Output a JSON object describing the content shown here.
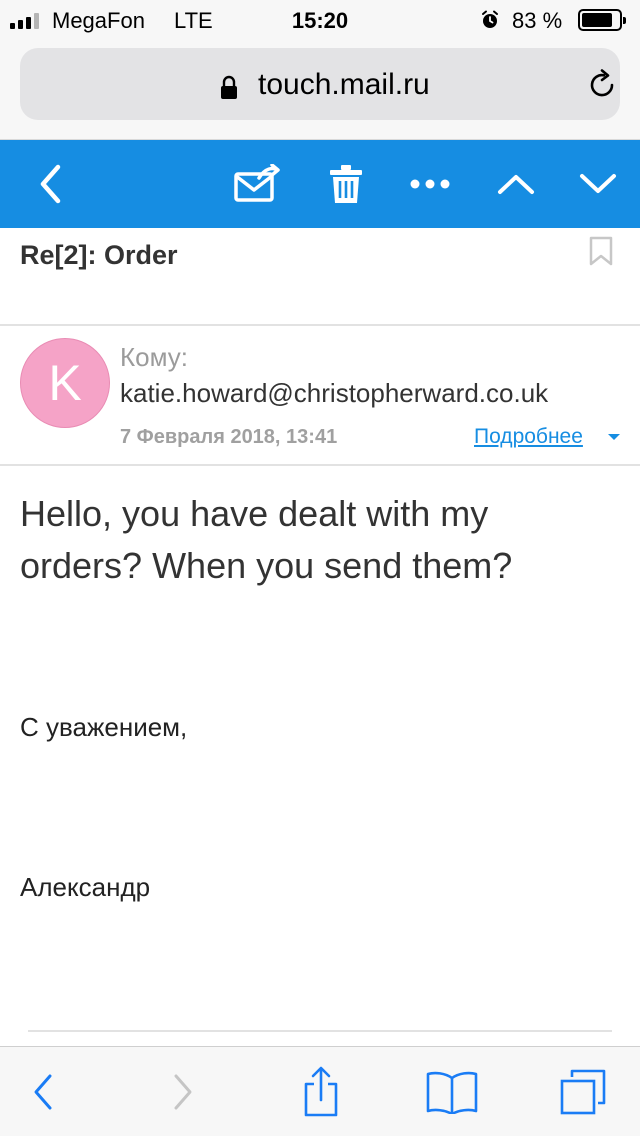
{
  "status_bar": {
    "carrier": "MegaFon",
    "network": "LTE",
    "time": "15:20",
    "battery_percent": "83 %",
    "battery_level": 0.83,
    "icons": [
      "signal-icon",
      "alarm-icon",
      "battery-icon"
    ]
  },
  "browser": {
    "url": "touch.mail.ru",
    "icons": [
      "lock-icon",
      "reload-icon"
    ]
  },
  "mail_toolbar": {
    "color": "#168de2",
    "buttons": [
      "back-icon",
      "move-icon",
      "trash-icon",
      "more-icon",
      "prev-message-icon",
      "next-message-icon"
    ]
  },
  "message": {
    "subject": "Re[2]: Order",
    "avatar_letter": "K",
    "avatar_color": "#f5a3c7",
    "to_label": "Кому:",
    "to_email": "katie.howard@christopherward.co.uk",
    "date": "7 Февраля 2018, 13:41",
    "details_link": "Подробнее",
    "body": "Hello, you have dealt with my orders? When you send them?",
    "signature_line1": "С уважением,",
    "signature_line2": "Александр"
  },
  "safari_toolbar": {
    "accent": "#1a7cf5",
    "buttons": [
      "back-icon",
      "forward-icon",
      "share-icon",
      "bookmarks-icon",
      "tabs-icon"
    ]
  }
}
